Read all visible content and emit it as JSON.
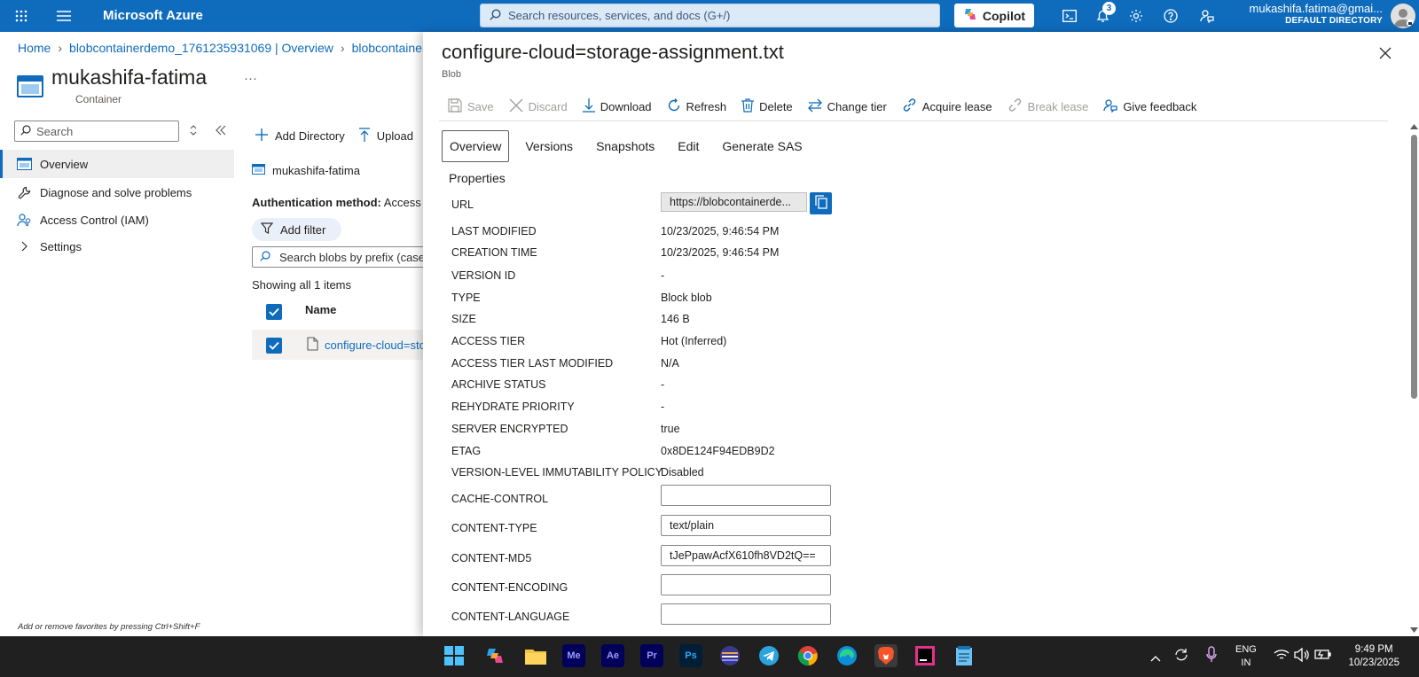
{
  "topbar": {
    "brand": "Microsoft Azure",
    "search_placeholder": "Search resources, services, and docs (G+/)",
    "copilot_label": "Copilot",
    "notification_count": "3",
    "user_email": "mukashifa.fatima@gmai...",
    "user_directory": "DEFAULT DIRECTORY",
    "accent_color": "#0f6cbd"
  },
  "breadcrumb": {
    "items": [
      "Home",
      "blobcontainerdemo_1761235931069 | Overview",
      "blobcontainer"
    ]
  },
  "resource": {
    "title": "mukashifa-fatima",
    "subtitle": "Container",
    "more": "···"
  },
  "sidebar": {
    "search_placeholder": "Search",
    "items": [
      {
        "label": "Overview",
        "icon": "container-icon"
      },
      {
        "label": "Diagnose and solve problems",
        "icon": "wrench-icon"
      },
      {
        "label": "Access Control (IAM)",
        "icon": "people-icon"
      },
      {
        "label": "Settings",
        "icon": "chevron-right-icon"
      }
    ],
    "favorites_hint": "Add or remove favorites by pressing Ctrl+Shift+F"
  },
  "container_view": {
    "toolbar": {
      "add_directory": "Add Directory",
      "upload": "Upload"
    },
    "container_name": "mukashifa-fatima",
    "auth_label": "Authentication method:",
    "auth_value": "Access k",
    "add_filter": "Add filter",
    "blob_search_placeholder": "Search blobs by prefix (case",
    "showing": "Showing all 1 items",
    "column_name": "Name",
    "rows": [
      {
        "name": "configure-cloud=sto"
      }
    ]
  },
  "panel": {
    "title": "configure-cloud=storage-assignment.txt",
    "subtitle": "Blob",
    "toolbar": [
      {
        "label": "Save",
        "enabled": false
      },
      {
        "label": "Discard",
        "enabled": false
      },
      {
        "label": "Download",
        "enabled": true
      },
      {
        "label": "Refresh",
        "enabled": true
      },
      {
        "label": "Delete",
        "enabled": true
      },
      {
        "label": "Change tier",
        "enabled": true
      },
      {
        "label": "Acquire lease",
        "enabled": true
      },
      {
        "label": "Break lease",
        "enabled": false
      },
      {
        "label": "Give feedback",
        "enabled": true
      }
    ],
    "tabs": [
      "Overview",
      "Versions",
      "Snapshots",
      "Edit",
      "Generate SAS"
    ],
    "properties_heading": "Properties",
    "url_label": "URL",
    "url_value": "https://blobcontainerde...",
    "properties": [
      {
        "label": "LAST MODIFIED",
        "value": "10/23/2025, 9:46:54 PM"
      },
      {
        "label": "CREATION TIME",
        "value": "10/23/2025, 9:46:54 PM"
      },
      {
        "label": "VERSION ID",
        "value": "-"
      },
      {
        "label": "TYPE",
        "value": "Block blob"
      },
      {
        "label": "SIZE",
        "value": "146 B"
      },
      {
        "label": "ACCESS TIER",
        "value": "Hot (Inferred)"
      },
      {
        "label": "ACCESS TIER LAST MODIFIED",
        "value": "N/A"
      },
      {
        "label": "ARCHIVE STATUS",
        "value": "-"
      },
      {
        "label": "REHYDRATE PRIORITY",
        "value": "-"
      },
      {
        "label": "SERVER ENCRYPTED",
        "value": "true"
      },
      {
        "label": "ETAG",
        "value": "0x8DE124F94EDB9D2"
      },
      {
        "label": "VERSION-LEVEL IMMUTABILITY POLICY",
        "value": "Disabled"
      }
    ],
    "editable_properties": [
      {
        "label": "CACHE-CONTROL",
        "value": ""
      },
      {
        "label": "CONTENT-TYPE",
        "value": "text/plain"
      },
      {
        "label": "CONTENT-MD5",
        "value": "tJePpawAcfX610fh8VD2tQ=="
      },
      {
        "label": "CONTENT-ENCODING",
        "value": ""
      },
      {
        "label": "CONTENT-LANGUAGE",
        "value": ""
      }
    ]
  },
  "taskbar": {
    "apps": [
      "windows-start",
      "copilot-app",
      "file-explorer",
      "Me",
      "Ae",
      "Pr",
      "Ps",
      "app-stripes",
      "telegram",
      "chrome",
      "edge",
      "brave",
      "jetbrains",
      "notepad"
    ],
    "language": "ENG",
    "region": "IN",
    "time": "9:49 PM",
    "date": "10/23/2025"
  }
}
